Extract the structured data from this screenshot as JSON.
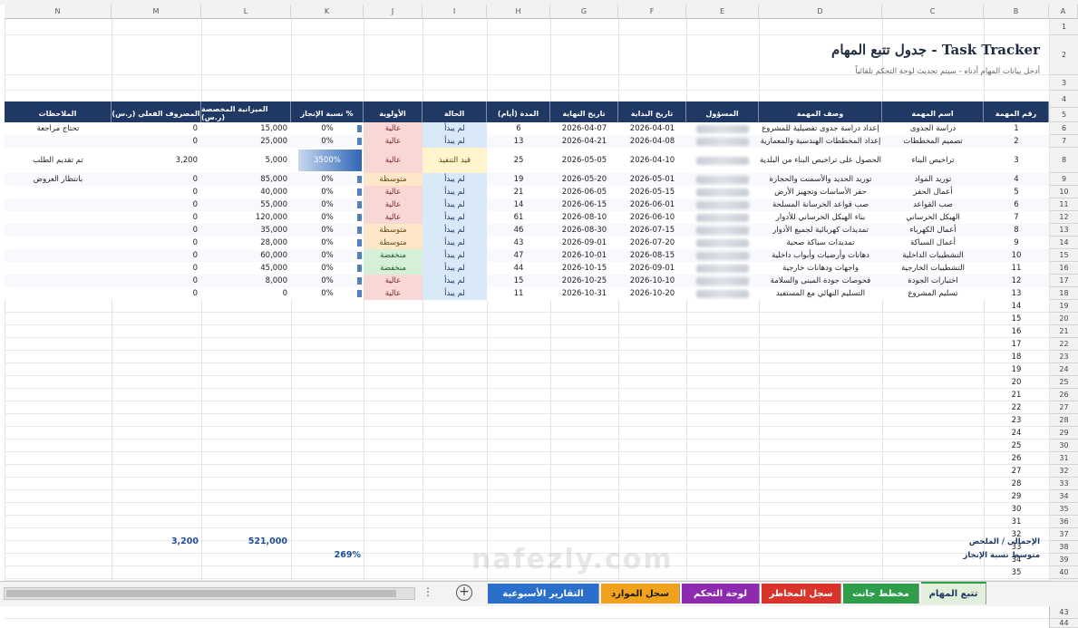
{
  "columns": [
    "A",
    "B",
    "C",
    "D",
    "E",
    "F",
    "G",
    "H",
    "I",
    "J",
    "K",
    "L",
    "M",
    "N"
  ],
  "title": "جدول تتبع المهام - Task Tracker",
  "subtitle": "أدخل بيانات المهام أدناه - سيتم تحديث لوحة التحكم تلقائياً",
  "headers": {
    "task_no": "رقم المهمة",
    "task_name": "اسم المهمة",
    "task_desc": "وصف المهمة",
    "owner": "المسؤول",
    "start": "تاريخ البداية",
    "end": "تاريخ النهاية",
    "duration": "المدة (أيام)",
    "status": "الحالة",
    "priority": "الأولوية",
    "progress": "نسبة الإنجاز %",
    "budget": "الميزانية المخصصة (ر.س)",
    "spent": "المصروف الفعلي (ر.س)",
    "notes": "الملاحظات"
  },
  "tasks": [
    {
      "no": "1",
      "name": "دراسة الجدوى",
      "desc": "إعداد دراسة جدوى تفصيلية للمشروع",
      "start": "2026-04-01",
      "end": "2026-04-07",
      "duration": "6",
      "status": "لم يبدأ",
      "status_kind": "ns",
      "priority": "عالية",
      "priority_kind": "high",
      "progress": "0%",
      "progress_val": 0,
      "budget": "15,000",
      "spent": "0",
      "notes": "تحتاج مراجعة"
    },
    {
      "no": "2",
      "name": "تصميم المخططات",
      "desc": "إعداد المخططات الهندسية والمعمارية",
      "start": "2026-04-08",
      "end": "2026-04-21",
      "duration": "13",
      "status": "لم يبدأ",
      "status_kind": "ns",
      "priority": "عالية",
      "priority_kind": "high",
      "progress": "0%",
      "progress_val": 0,
      "budget": "25,000",
      "spent": "0",
      "notes": ""
    },
    {
      "no": "3",
      "name": "تراخيص البناء",
      "desc": "الحصول على تراخيص البناء من البلدية",
      "start": "2026-04-10",
      "end": "2026-05-05",
      "duration": "25",
      "status": "قيد التنفيذ",
      "status_kind": "ip",
      "priority": "عالية",
      "priority_kind": "high",
      "progress": "3500%",
      "progress_val": 1,
      "budget": "5,000",
      "spent": "3,200",
      "notes": "تم تقديم الطلب"
    },
    {
      "no": "4",
      "name": "توريد المواد",
      "desc": "توريد الحديد والأسمنت والحجارة",
      "start": "2026-05-01",
      "end": "2026-05-20",
      "duration": "19",
      "status": "لم يبدأ",
      "status_kind": "ns",
      "priority": "متوسطة",
      "priority_kind": "med",
      "progress": "0%",
      "progress_val": 0,
      "budget": "85,000",
      "spent": "0",
      "notes": "بانتظار العروض"
    },
    {
      "no": "5",
      "name": "أعمال الحفر",
      "desc": "حفر الأساسات وتجهيز الأرض",
      "start": "2026-05-15",
      "end": "2026-06-05",
      "duration": "21",
      "status": "لم يبدأ",
      "status_kind": "ns",
      "priority": "عالية",
      "priority_kind": "high",
      "progress": "0%",
      "progress_val": 0,
      "budget": "40,000",
      "spent": "0",
      "notes": ""
    },
    {
      "no": "6",
      "name": "صب القواعد",
      "desc": "صب قواعد الخرسانة المسلحة",
      "start": "2026-06-01",
      "end": "2026-06-15",
      "duration": "14",
      "status": "لم يبدأ",
      "status_kind": "ns",
      "priority": "عالية",
      "priority_kind": "high",
      "progress": "0%",
      "progress_val": 0,
      "budget": "55,000",
      "spent": "0",
      "notes": ""
    },
    {
      "no": "7",
      "name": "الهيكل الخرساني",
      "desc": "بناء الهيكل الخرساني للأدوار",
      "start": "2026-06-10",
      "end": "2026-08-10",
      "duration": "61",
      "status": "لم يبدأ",
      "status_kind": "ns",
      "priority": "عالية",
      "priority_kind": "high",
      "progress": "0%",
      "progress_val": 0,
      "budget": "120,000",
      "spent": "0",
      "notes": ""
    },
    {
      "no": "8",
      "name": "أعمال الكهرباء",
      "desc": "تمديدات كهربائية لجميع الأدوار",
      "start": "2026-07-15",
      "end": "2026-08-30",
      "duration": "46",
      "status": "لم يبدأ",
      "status_kind": "ns",
      "priority": "متوسطة",
      "priority_kind": "med",
      "progress": "0%",
      "progress_val": 0,
      "budget": "35,000",
      "spent": "0",
      "notes": ""
    },
    {
      "no": "9",
      "name": "أعمال السباكة",
      "desc": "تمديدات سباكة صحية",
      "start": "2026-07-20",
      "end": "2026-09-01",
      "duration": "43",
      "status": "لم يبدأ",
      "status_kind": "ns",
      "priority": "متوسطة",
      "priority_kind": "med",
      "progress": "0%",
      "progress_val": 0,
      "budget": "28,000",
      "spent": "0",
      "notes": ""
    },
    {
      "no": "10",
      "name": "التشطيبات الداخلية",
      "desc": "دهانات وأرضيات وأبواب داخلية",
      "start": "2026-08-15",
      "end": "2026-10-01",
      "duration": "47",
      "status": "لم يبدأ",
      "status_kind": "ns",
      "priority": "منخفضة",
      "priority_kind": "low",
      "progress": "0%",
      "progress_val": 0,
      "budget": "60,000",
      "spent": "0",
      "notes": ""
    },
    {
      "no": "11",
      "name": "التشطيبات الخارجية",
      "desc": "واجهات ودهانات خارجية",
      "start": "2026-09-01",
      "end": "2026-10-15",
      "duration": "44",
      "status": "لم يبدأ",
      "status_kind": "ns",
      "priority": "منخفضة",
      "priority_kind": "low",
      "progress": "0%",
      "progress_val": 0,
      "budget": "45,000",
      "spent": "0",
      "notes": ""
    },
    {
      "no": "12",
      "name": "اختبارات الجودة",
      "desc": "فحوصات جودة المبنى والسلامة",
      "start": "2026-10-10",
      "end": "2026-10-25",
      "duration": "15",
      "status": "لم يبدأ",
      "status_kind": "ns",
      "priority": "عالية",
      "priority_kind": "high",
      "progress": "0%",
      "progress_val": 0,
      "budget": "8,000",
      "spent": "0",
      "notes": ""
    },
    {
      "no": "13",
      "name": "تسليم المشروع",
      "desc": "التسليم النهائي مع المستفيد",
      "start": "2026-10-20",
      "end": "2026-10-31",
      "duration": "11",
      "status": "لم يبدأ",
      "status_kind": "ns",
      "priority": "عالية",
      "priority_kind": "high",
      "progress": "0%",
      "progress_val": 0,
      "budget": "0",
      "spent": "0",
      "notes": ""
    }
  ],
  "empty_numbers": [
    "14",
    "15",
    "16",
    "17",
    "18",
    "19",
    "20",
    "21",
    "22",
    "23",
    "24",
    "25",
    "26",
    "27",
    "28",
    "29",
    "30",
    "31",
    "32",
    "33",
    "34",
    "35",
    "36"
  ],
  "summary": {
    "total_label": "الإجمالي / الملخص",
    "total_budget": "521,000",
    "total_spent": "3,200",
    "avg_label": "متوسط نسبة الإنجاز",
    "avg_progress": "269%"
  },
  "tabs": [
    {
      "label": "تتبع المهام",
      "color": "#e2efda",
      "text": "#1f3864",
      "active": true
    },
    {
      "label": "مخطط جانت",
      "color": "#2e9e4a",
      "text": "#ffffff",
      "active": false
    },
    {
      "label": "سجل المخاطر",
      "color": "#d9342b",
      "text": "#ffffff",
      "active": false
    },
    {
      "label": "لوحة التحكم",
      "color": "#8e2ab0",
      "text": "#ffffff",
      "active": false
    },
    {
      "label": "سجل الموارد",
      "color": "#f0a21c",
      "text": "#1b1b1b",
      "active": false
    },
    {
      "label": "التقارير الأسبوعية",
      "color": "#2a6fc9",
      "text": "#ffffff",
      "active": false
    }
  ],
  "watermark": "nafezly.com"
}
